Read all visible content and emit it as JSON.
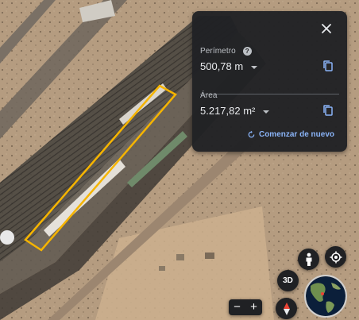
{
  "panel": {
    "perimeter_label": "Perímetro",
    "perimeter_value": "500,78 m",
    "area_label": "Área",
    "area_value": "5.217,82 m²",
    "restart_label": "Comenzar de nuevo",
    "icons": {
      "close": "close-icon",
      "help": "help-icon",
      "copy": "copy-icon",
      "restart": "restart-icon",
      "unit_dropdown": "chevron-down-icon"
    }
  },
  "controls": {
    "btn_3d": "3D",
    "zoom_out": "−",
    "zoom_in": "+",
    "icons": [
      "pegman-icon",
      "my-location-icon",
      "compass-icon",
      "globe-icon"
    ]
  },
  "colors": {
    "panel_bg": "#202124",
    "accent": "#8ab4f8",
    "polygon": "#f5b400"
  }
}
